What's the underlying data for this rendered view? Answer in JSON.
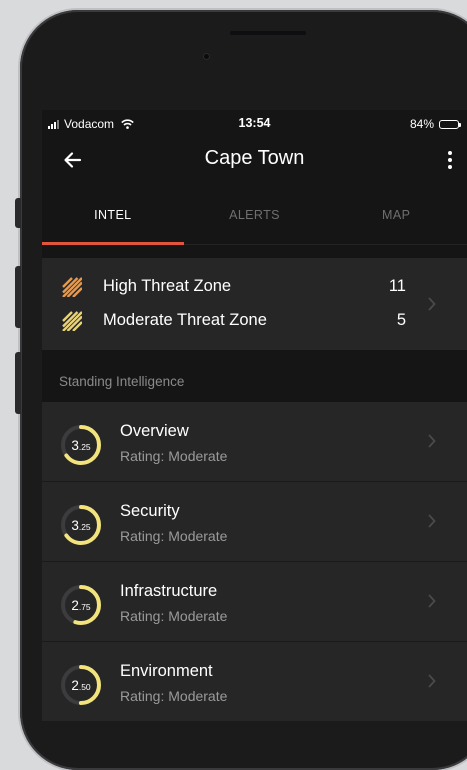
{
  "status_bar": {
    "carrier": "Vodacom",
    "time": "13:54",
    "battery": "84%",
    "battery_level": 0.84,
    "icons": [
      "signal-bars-icon",
      "wifi-icon",
      "battery-icon"
    ]
  },
  "nav": {
    "title": "Cape Town",
    "back_icon": "arrow-left-icon",
    "more_icon": "vertical-ellipsis-icon"
  },
  "tabs": [
    {
      "label": "INTEL",
      "active": true
    },
    {
      "label": "ALERTS",
      "active": false
    },
    {
      "label": "MAP",
      "active": false
    }
  ],
  "threat_zones": [
    {
      "label": "High Threat Zone",
      "count": "11",
      "color": "#e49a52"
    },
    {
      "label": "Moderate Threat Zone",
      "count": "5",
      "color": "#e8d37a"
    }
  ],
  "section_header": "Standing Intelligence",
  "intel_items": [
    {
      "title": "Overview",
      "subtitle": "Rating: Moderate",
      "rating_whole": "3",
      "rating_frac": ".25",
      "rating": 3.25
    },
    {
      "title": "Security",
      "subtitle": "Rating: Moderate",
      "rating_whole": "3",
      "rating_frac": ".25",
      "rating": 3.25
    },
    {
      "title": "Infrastructure",
      "subtitle": "Rating: Moderate",
      "rating_whole": "2",
      "rating_frac": ".75",
      "rating": 2.75
    },
    {
      "title": "Environment",
      "subtitle": "Rating: Moderate",
      "rating_whole": "2",
      "rating_frac": ".50",
      "rating": 2.5
    }
  ],
  "colors": {
    "accent": "#e4533b",
    "rating_ring": "#f2e37c",
    "ring_track": "#3c3c3e",
    "card": "#262626",
    "screen_bg": "#151515"
  },
  "rating_scale_max": 5
}
